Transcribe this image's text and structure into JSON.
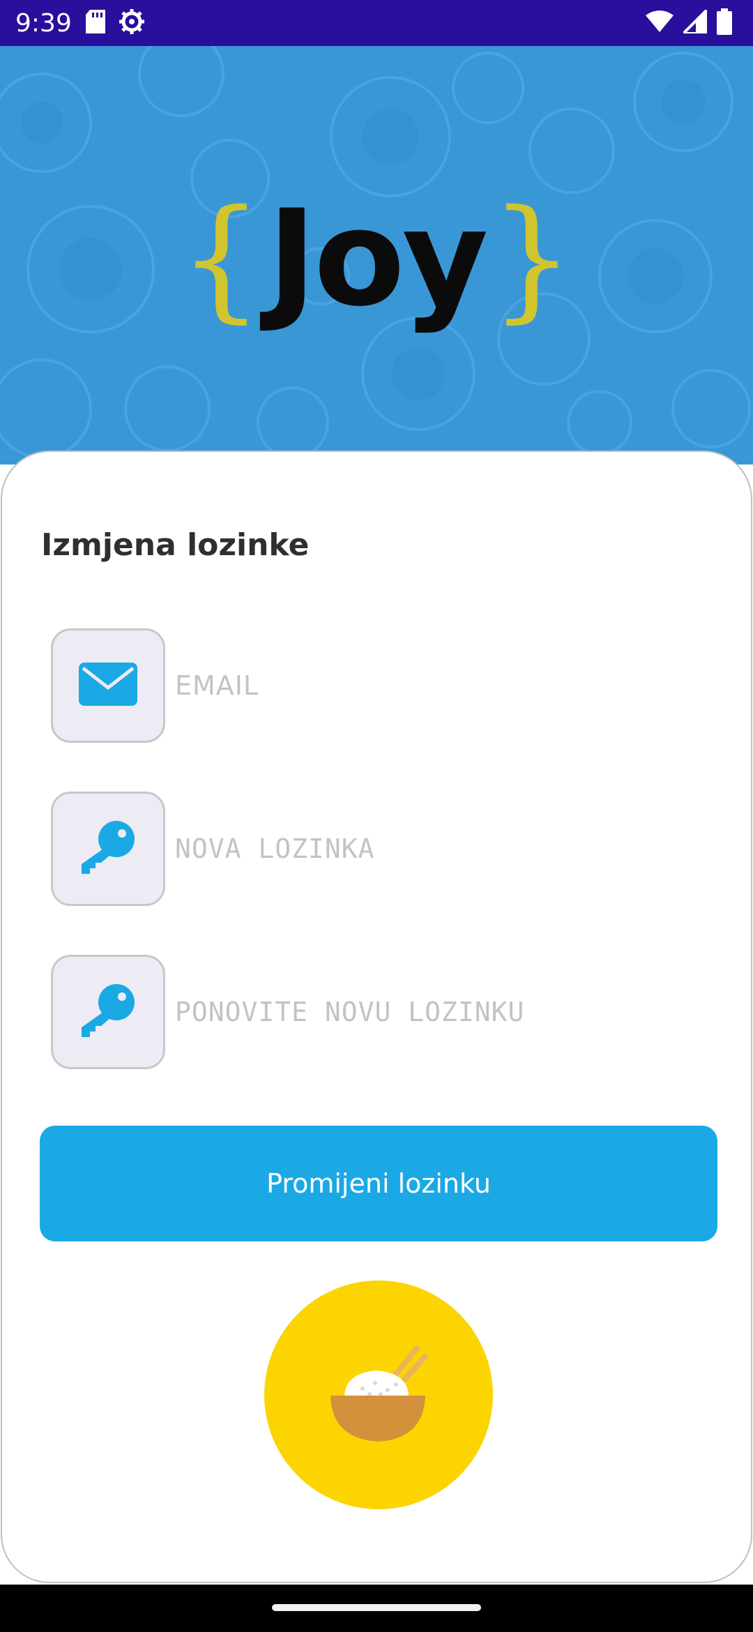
{
  "status_bar": {
    "time": "9:39",
    "icons": [
      "sd-card-icon",
      "settings-gear-icon",
      "wifi-icon",
      "signal-icon",
      "battery-icon"
    ],
    "background": "#2a0e9c"
  },
  "header": {
    "logo": {
      "open_brace": "{",
      "text": "Joy",
      "close_brace": "}"
    },
    "background": "#3a97d6"
  },
  "form": {
    "title": "Izmjena lozinke",
    "fields": [
      {
        "icon": "envelope-icon",
        "placeholder": "EMAIL"
      },
      {
        "icon": "key-icon",
        "placeholder": "NOVA LOZINKA"
      },
      {
        "icon": "key-icon",
        "placeholder": "PONOVITE NOVU LOZINKU"
      }
    ],
    "submit_label": "Promijeni lozinku",
    "accent": "#1aa9e5",
    "badge": {
      "icon": "rice-bowl-icon",
      "color": "#fcd402"
    }
  }
}
